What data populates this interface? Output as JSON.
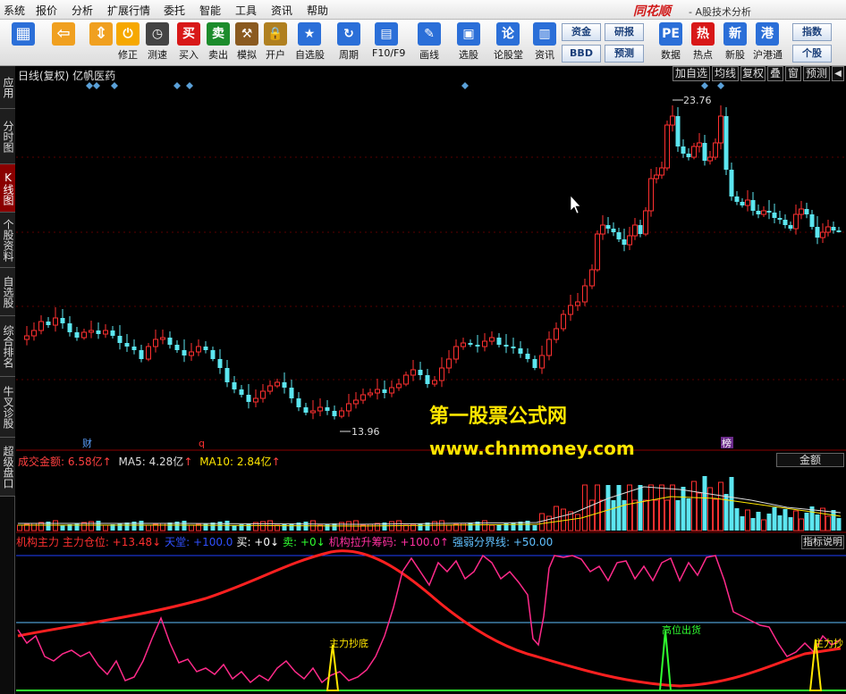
{
  "menubar": {
    "items": [
      "系统",
      "报价",
      "分析",
      "扩展行情",
      "委托",
      "智能",
      "工具",
      "资讯",
      "帮助"
    ],
    "brand": "同花顺",
    "subtitle": "- A股技术分析"
  },
  "toolbar": {
    "buttons": [
      {
        "label": "",
        "icon": "layout-icon",
        "color": "#2b6fd8"
      },
      {
        "label": "",
        "icon": "back-arrow-icon",
        "color": "#f0a020"
      },
      {
        "label": "",
        "icon": "updown-arrow-icon",
        "color": "#f0a020"
      },
      {
        "label": "修正",
        "icon": "power-icon",
        "color": "#f6a800"
      },
      {
        "label": "测速",
        "icon": "clock-icon",
        "color": "#444"
      },
      {
        "label": "买入",
        "icon": "buy-icon",
        "color": "#d81818"
      },
      {
        "label": "卖出",
        "icon": "sell-icon",
        "color": "#1c8c2c"
      },
      {
        "label": "模拟",
        "icon": "hammer-icon",
        "color": "#8a5a20"
      },
      {
        "label": "开户",
        "icon": "lock-icon",
        "color": "#b08020"
      },
      {
        "label": "自选股",
        "icon": "star-icon",
        "color": "#2b6fd8"
      },
      {
        "label": "周期",
        "icon": "cycle-icon",
        "color": "#2b6fd8"
      },
      {
        "label": "F10/F9",
        "icon": "f10-icon",
        "color": "#2b6fd8"
      },
      {
        "label": "画线",
        "icon": "pen-icon",
        "color": "#2b6fd8"
      },
      {
        "label": "选股",
        "icon": "select-icon",
        "color": "#2b6fd8"
      },
      {
        "label": "论股堂",
        "icon": "forum-icon",
        "color": "#2b6fd8"
      },
      {
        "label": "资讯",
        "icon": "news-icon",
        "color": "#2b6fd8"
      },
      {
        "label": "数据",
        "icon": "pe-icon",
        "color": "#2b6fd8"
      },
      {
        "label": "热点",
        "icon": "hot-icon",
        "color": "#d81818"
      },
      {
        "label": "新股",
        "icon": "ipo-icon",
        "color": "#2b6fd8"
      },
      {
        "label": "沪港通",
        "icon": "sse-hkex-icon",
        "color": "#2b6fd8"
      }
    ],
    "small_buttons": [
      "资金",
      "BBD",
      "研报",
      "预测",
      "指数",
      "个股"
    ]
  },
  "sidebar": {
    "tabs": [
      "应用",
      "分时图",
      "K线图",
      "个股资料",
      "自选股",
      "综合排名",
      "牛叉诊股",
      "超级盘口"
    ]
  },
  "chart": {
    "title": "日线(复权) 亿帆医药",
    "right_buttons": [
      "加自选",
      "均线",
      "复权",
      "叠",
      "窗",
      "预测"
    ],
    "high_label": "23.76",
    "low_label": "13.96",
    "markers": [
      "财",
      "q",
      "榜"
    ],
    "watermark_title": "第一股票公式网",
    "watermark_url": "www.chnmoney.com"
  },
  "volume_panel": {
    "label": "成交金额:",
    "value": "6.58亿",
    "ma5_label": "MA5:",
    "ma5_value": "4.28亿",
    "ma10_label": "MA10:",
    "ma10_value": "2.84亿",
    "right_button": "金额"
  },
  "indicator_panel": {
    "name": "机构主力",
    "items": [
      {
        "label": "主力仓位:",
        "value": "+13.48",
        "arrow": "↓",
        "color": "#ff3030"
      },
      {
        "label": "天堂:",
        "value": "+100.0",
        "arrow": "",
        "color": "#3050ff"
      },
      {
        "label": "买:",
        "value": "+0",
        "arrow": "↓",
        "color": "#ffffff"
      },
      {
        "label": "卖:",
        "value": "+0",
        "arrow": "↓",
        "color": "#30ff30"
      },
      {
        "label": "机构拉升筹码:",
        "value": "+100.0",
        "arrow": "↑",
        "color": "#ff30a0"
      },
      {
        "label": "强弱分界线:",
        "value": "+50.00",
        "arrow": "",
        "color": "#60c0ff"
      }
    ],
    "right_button": "指标说明",
    "signals": [
      "主力抄底",
      "高位出货",
      "主力抄"
    ]
  }
}
